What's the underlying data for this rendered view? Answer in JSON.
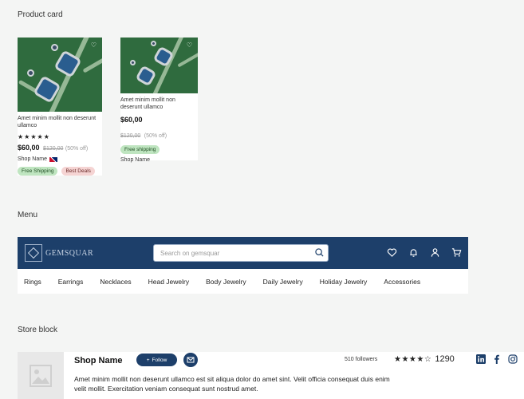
{
  "sections": {
    "product_card": "Product card",
    "menu": "Menu",
    "store_block": "Store block"
  },
  "cards": [
    {
      "name": "Amet minim mollit non deserunt ullamco",
      "stars": "★★★★★",
      "price": "$60,00",
      "old_price": "$120,00",
      "discount": "(50% off)",
      "shop": "Shop Name",
      "badges": [
        "Free Shipping",
        "Best Deals"
      ]
    },
    {
      "name": "Amet minim mollit non deserunt ullamco",
      "price": "$60,00",
      "old_price": "$120,00",
      "discount": "(50% off)",
      "badge": "Free shipping",
      "shop": "Shop Name"
    }
  ],
  "menu": {
    "logo_text": "GEMSQUAR",
    "search_placeholder": "Search on gemsquar",
    "icons": [
      "heart-icon",
      "bell-icon",
      "user-icon",
      "cart-icon"
    ],
    "categories": [
      "Rings",
      "Earrings",
      "Necklaces",
      "Head Jewelry",
      "Body Jewelry",
      "Daily Jewelry",
      "Holiday Jewelry",
      "Accessories"
    ],
    "bar_color": "#1d3f6a"
  },
  "store": {
    "name": "Shop Name",
    "follow_label": "Follow",
    "followers": "510 followers",
    "rating_stars": "★★★★☆",
    "rating_count": "1290",
    "social": [
      "linkedin-icon",
      "facebook-icon",
      "instagram-icon"
    ],
    "description": "Amet minim mollit non deserunt ullamco est sit aliqua dolor do amet sint. Velit officia consequat duis enim velit mollit. Exercitation veniam consequat sunt nostrud amet."
  }
}
